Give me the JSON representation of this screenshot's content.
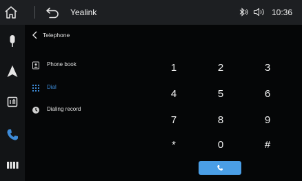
{
  "topbar": {
    "title": "Yealink",
    "time": "10:36"
  },
  "header": {
    "title": "Telephone"
  },
  "menu": [
    {
      "label": "Phone book",
      "icon": "contacts-icon"
    },
    {
      "label": "Dial",
      "icon": "keypad-icon",
      "active": true
    },
    {
      "label": "Dialing record",
      "icon": "clock-icon"
    }
  ],
  "keypad": [
    "1",
    "2",
    "3",
    "4",
    "5",
    "6",
    "7",
    "8",
    "9",
    "*",
    "0",
    "#"
  ],
  "colors": {
    "accent": "#3d8bd8",
    "call_button": "#4a9ee6",
    "background": "#050607"
  }
}
